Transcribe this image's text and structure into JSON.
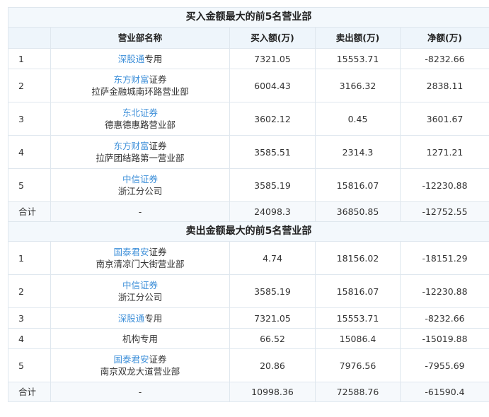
{
  "columns": [
    "营业部名称",
    "买入额(万)",
    "卖出额(万)",
    "净额(万)"
  ],
  "buy_section": {
    "title": "买入金额最大的前5名营业部",
    "rows": [
      {
        "rank": "1",
        "broker_link": "深股通",
        "broker_rest": "专用",
        "branch": "",
        "buy": "7321.05",
        "sell": "15553.71",
        "net": "-8232.66"
      },
      {
        "rank": "2",
        "broker_link": "东方财富",
        "broker_rest": "证券",
        "branch": "拉萨金融城南环路营业部",
        "buy": "6004.43",
        "sell": "3166.32",
        "net": "2838.11"
      },
      {
        "rank": "3",
        "broker_link": "东北证券",
        "broker_rest": "",
        "branch": "德惠德惠路营业部",
        "buy": "3602.12",
        "sell": "0.45",
        "net": "3601.67"
      },
      {
        "rank": "4",
        "broker_link": "东方财富",
        "broker_rest": "证券",
        "branch": "拉萨团结路第一营业部",
        "buy": "3585.51",
        "sell": "2314.3",
        "net": "1271.21"
      },
      {
        "rank": "5",
        "broker_link": "中信证券",
        "broker_rest": "",
        "branch": "浙江分公司",
        "buy": "3585.19",
        "sell": "15816.07",
        "net": "-12230.88"
      }
    ],
    "total": {
      "label": "合计",
      "name": "-",
      "buy": "24098.3",
      "sell": "36850.85",
      "net": "-12752.55"
    }
  },
  "sell_section": {
    "title": "卖出金额最大的前5名营业部",
    "rows": [
      {
        "rank": "1",
        "broker_link": "国泰君安",
        "broker_rest": "证券",
        "branch": "南京清凉门大街营业部",
        "buy": "4.74",
        "sell": "18156.02",
        "net": "-18151.29"
      },
      {
        "rank": "2",
        "broker_link": "中信证券",
        "broker_rest": "",
        "branch": "浙江分公司",
        "buy": "3585.19",
        "sell": "15816.07",
        "net": "-12230.88"
      },
      {
        "rank": "3",
        "broker_link": "深股通",
        "broker_rest": "专用",
        "branch": "",
        "buy": "7321.05",
        "sell": "15553.71",
        "net": "-8232.66"
      },
      {
        "rank": "4",
        "broker_link": "",
        "broker_rest": "机构专用",
        "branch": "",
        "buy": "66.52",
        "sell": "15086.4",
        "net": "-15019.88"
      },
      {
        "rank": "5",
        "broker_link": "国泰君安",
        "broker_rest": "证券",
        "branch": "南京双龙大道营业部",
        "buy": "20.86",
        "sell": "7976.56",
        "net": "-7955.69"
      }
    ],
    "total": {
      "label": "合计",
      "name": "-",
      "buy": "10998.36",
      "sell": "72588.76",
      "net": "-61590.4"
    }
  }
}
